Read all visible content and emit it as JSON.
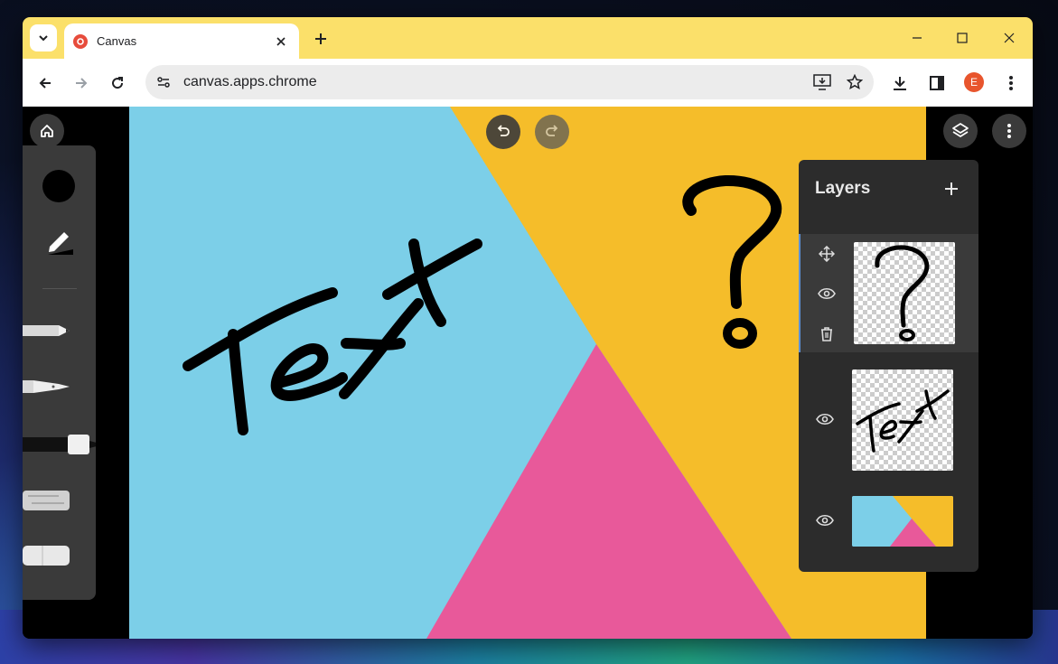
{
  "browser": {
    "tab_title": "Canvas",
    "url": "canvas.apps.chrome",
    "profile_initial": "E"
  },
  "layers_panel": {
    "title": "Layers",
    "layers": [
      {
        "name": "question-mark-layer",
        "selected": true
      },
      {
        "name": "text-layer",
        "selected": false
      },
      {
        "name": "background-layer",
        "selected": false
      }
    ]
  },
  "canvas": {
    "drawn_text": "Text",
    "drawn_symbol": "?"
  },
  "colors": {
    "tabbar": "#fbe06a",
    "panel": "#3a3a3a",
    "layers_panel": "#2c2c2c",
    "art_blue": "#7ccfe8",
    "art_yellow": "#f5bd2a",
    "art_pink": "#e8599a",
    "profile": "#e8552d",
    "brush": "#000000"
  },
  "icons": [
    "tab-search-icon",
    "canvas-favicon",
    "close-icon",
    "plus-icon",
    "minimize-icon",
    "maximize-icon",
    "window-close-icon",
    "back-icon",
    "forward-icon",
    "reload-icon",
    "site-info-icon",
    "install-app-icon",
    "star-icon",
    "download-icon",
    "side-panel-icon",
    "more-vert-icon",
    "home-icon",
    "undo-icon",
    "redo-icon",
    "layers-icon",
    "pencil-icon",
    "move-icon",
    "eye-icon",
    "trash-icon"
  ]
}
